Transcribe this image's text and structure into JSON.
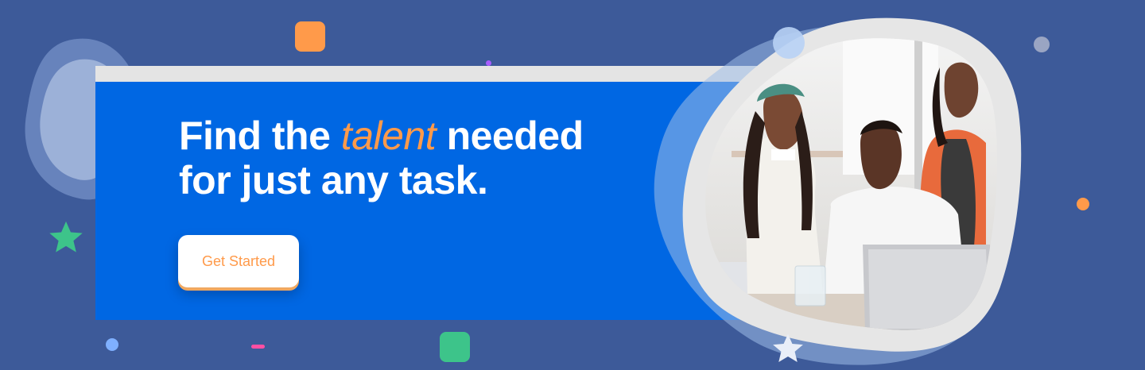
{
  "headline": {
    "before": "Find the",
    "highlight": "talent",
    "after_line1": "needed",
    "line2": "for just any task."
  },
  "cta": {
    "label": "Get Started"
  },
  "colors": {
    "background": "#3d5a99",
    "card": "#0067e3",
    "accent_orange": "#ff9a4a",
    "accent_green": "#3dc48a"
  },
  "decorations": [
    "blob-shape",
    "star-icon",
    "dot-shape",
    "square-shape"
  ],
  "photo": {
    "subject": "three people looking at a laptop"
  }
}
